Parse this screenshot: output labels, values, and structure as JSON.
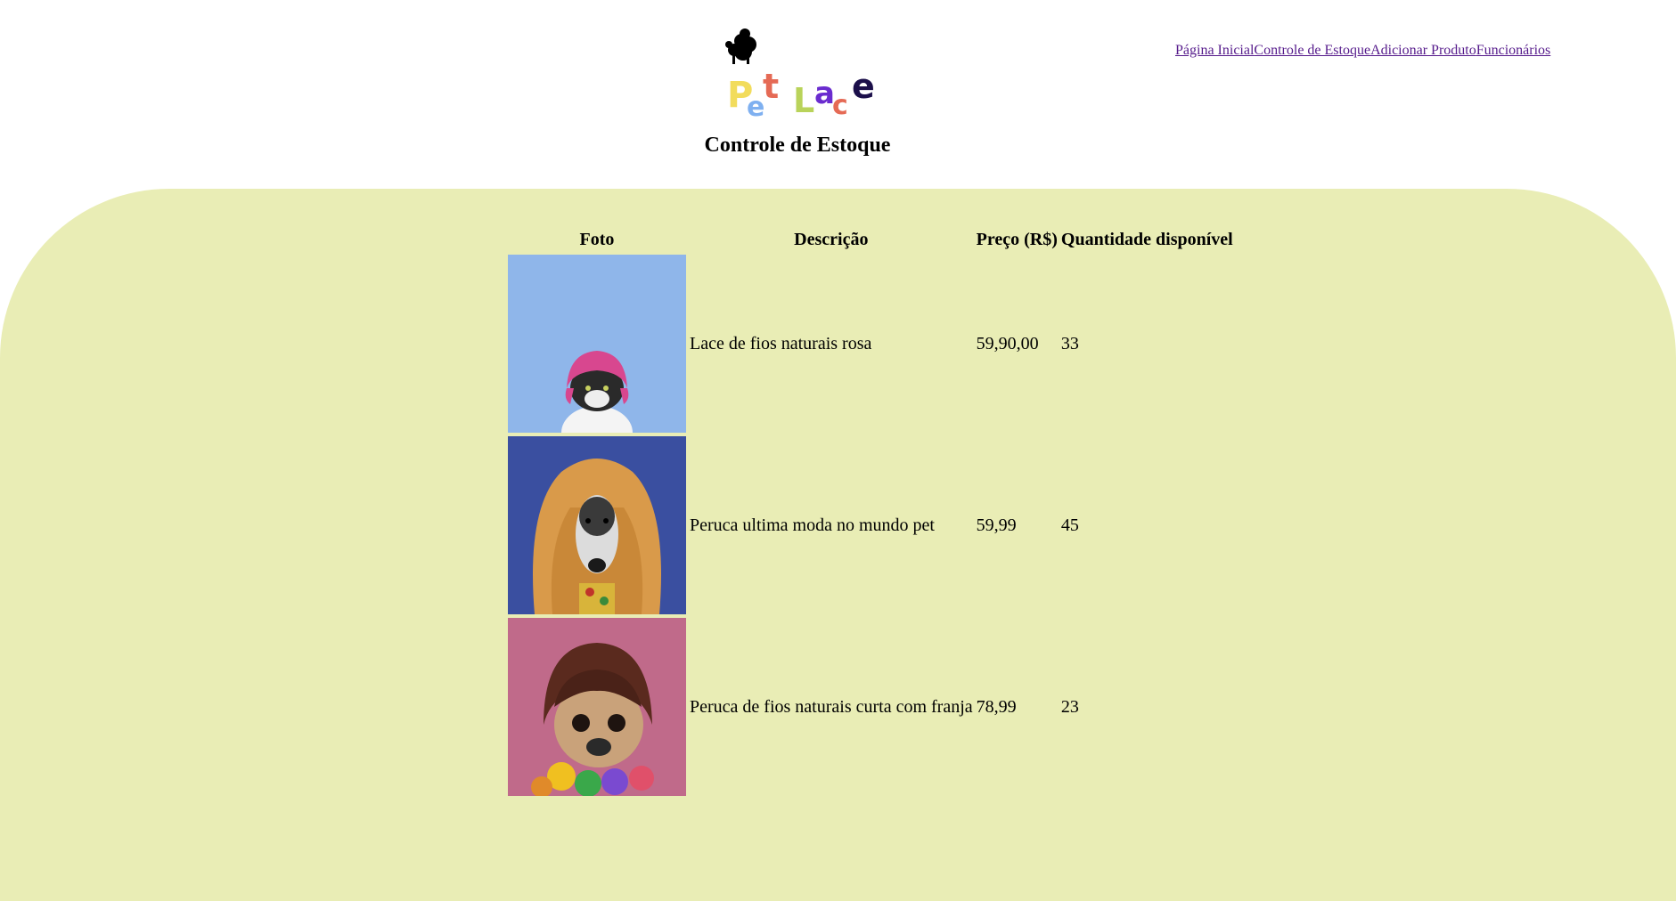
{
  "header": {
    "logo_alt": "Pet Lace",
    "nav": [
      {
        "label": "Página Inicial"
      },
      {
        "label": "Controle de Estoque"
      },
      {
        "label": "Adicionar Produto"
      },
      {
        "label": "Funcionários"
      }
    ]
  },
  "page": {
    "title": "Controle de Estoque"
  },
  "table": {
    "headers": [
      "Foto",
      "Descrição",
      "Preço (R$)",
      "Quantidade disponível"
    ],
    "rows": [
      {
        "description": "Lace de fios naturais rosa",
        "price": "59,90,00",
        "quantity": "33",
        "photo_bg": "#8fb6ea"
      },
      {
        "description": "Peruca ultima moda no mundo pet",
        "price": "59,99",
        "quantity": "45",
        "photo_bg": "#3a4fa0"
      },
      {
        "description": "Peruca de fios naturais curta com franja",
        "price": "78,99",
        "quantity": "23",
        "photo_bg": "#c06a8a"
      }
    ]
  },
  "colors": {
    "panel_bg": "#e9edb5",
    "link": "#551a8b"
  }
}
